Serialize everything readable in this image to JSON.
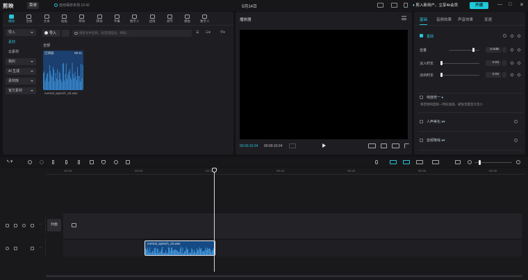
{
  "titlebar": {
    "logo": "剪映",
    "menu_label": "菜单",
    "autosave": "自动保存本地 10:42",
    "project_title": "5月14日",
    "promo_text": "剪入新用户，立享4k会员",
    "vip_label": "开通",
    "win_controls": [
      "—",
      "□",
      "✕"
    ]
  },
  "toolbar": {
    "tabs": [
      {
        "label": "媒体",
        "icon": "media-icon",
        "active": true
      },
      {
        "label": "音频",
        "icon": "audio-icon",
        "active": false
      },
      {
        "label": "文本",
        "icon": "text-icon",
        "active": false
      },
      {
        "label": "贴纸",
        "icon": "sticker-icon",
        "active": false
      },
      {
        "label": "特效",
        "icon": "effects-icon",
        "active": false
      },
      {
        "label": "转场",
        "icon": "transition-icon",
        "active": false
      },
      {
        "label": "字幕",
        "icon": "caption-icon",
        "active": false
      },
      {
        "label": "数字人",
        "icon": "avatar-icon",
        "active": false
      },
      {
        "label": "滤镜",
        "icon": "filter-icon",
        "active": false
      },
      {
        "label": "调节",
        "icon": "adjust-icon",
        "active": false
      },
      {
        "label": "模板",
        "icon": "template-icon",
        "active": false
      },
      {
        "label": "数字人",
        "icon": "digital-human-icon",
        "active": false
      }
    ]
  },
  "media": {
    "side_nav": [
      {
        "label": "导入",
        "boxed": true,
        "active": false
      },
      {
        "label": "素材",
        "boxed": false,
        "active": true
      },
      {
        "label": "云素材",
        "boxed": false,
        "active": false
      },
      {
        "label": "我的",
        "boxed": true,
        "active": false
      },
      {
        "label": "AI 生成",
        "boxed": true,
        "active": false
      },
      {
        "label": "素材库",
        "boxed": true,
        "active": false
      },
      {
        "label": "官方素材",
        "boxed": true,
        "active": false
      }
    ],
    "import_label": "导入",
    "search_placeholder": "搜索文件名称、标签或描述，例如...",
    "sort_label": "全部",
    "breadcrumb": "全部",
    "thumb": {
      "label": "已添加",
      "duration": "00:11",
      "name": "normal_speech_15.wav"
    }
  },
  "player": {
    "title": "播放器",
    "time_current": "00:00:10:24",
    "time_total": "00:00:10:24",
    "ratio_label": "比例"
  },
  "inspector": {
    "tabs": [
      "基础",
      "音频效果",
      "声音效果",
      "变速"
    ],
    "active_tab": 0,
    "section_basic": "基础",
    "rows": [
      {
        "label": "音量",
        "value": "0.0dB",
        "fraction": 0.78
      },
      {
        "label": "淡入时长",
        "value": "0.0s",
        "fraction": 0.0
      },
      {
        "label": "淡出时长",
        "value": "0.0s",
        "fraction": 0.0
      }
    ],
    "normalize_label": "响度统一",
    "normalize_note": "将音频响度统一到标准值，避免音量忽大忽小",
    "voice_enhance_label": "人声美化",
    "noise_label": "音频降噪"
  },
  "timeline": {
    "ruler": [
      "00:00",
      "00:05",
      "00:10",
      "00:15",
      "00:20",
      "00:25",
      "00:30"
    ],
    "cover_label": "封面",
    "clip_name": "normal_speech_15.wav"
  }
}
